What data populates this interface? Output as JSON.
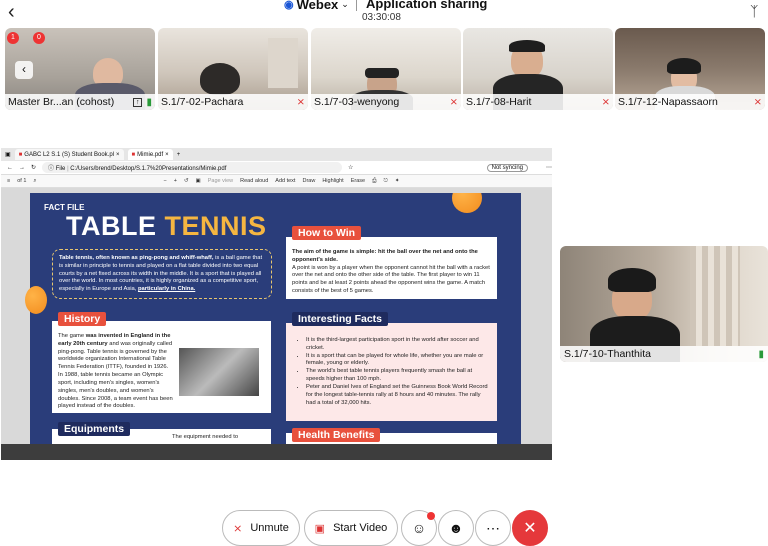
{
  "status": {
    "back_icon": "chevron-left-icon",
    "app_name": "Webex",
    "share_label": "Application sharing",
    "timer": "03:30:08",
    "bluetooth_icon": "bluetooth-icon"
  },
  "participants": [
    {
      "name": "Master Br...an (cohost)",
      "mic": "on"
    },
    {
      "name": "S.1/7-02-Pachara",
      "mic": "off"
    },
    {
      "name": "S.1/7-03-wenyong",
      "mic": "off"
    },
    {
      "name": "S.1/7-08-Harit",
      "mic": "off"
    },
    {
      "name": "S.1/7-12-Napassaorn",
      "mic": "off"
    }
  ],
  "first_tile_badges": [
    "1",
    "0"
  ],
  "side_participant": {
    "name": "S.1/7-10-Thanthita",
    "mic": "on"
  },
  "browser": {
    "tabs": [
      "GABC L2 S.1 (S) Student Book.pl",
      "Mimie.pdf"
    ],
    "file_label": "File",
    "url": "C:/Users/brend/Desktop/S.1.7%20Presentations/Mimie.pdf",
    "sync_label": "Not syncing",
    "page_counter": "of 1",
    "tools": [
      "Page view",
      "Read aloud",
      "Add text",
      "Draw",
      "Highlight",
      "Erase"
    ]
  },
  "pdf": {
    "fact_file": "FACT FILE",
    "title_a": "TABLE",
    "title_b": "TENNIS",
    "intro_bold": "Table tennis, often known as ping-pong and whiff-whaff,",
    "intro_rest": " is a ball game that is similar in principle to tennis and played on a flat table divided into two equal courts by a net fixed across its width in the middle. It is a sport that is played all over the world. In most countries, it is highly organized as a competitive sport, especially in Europe and Asia, ",
    "intro_link": "particularly in China.",
    "how_to_win": "How to Win",
    "htw_bold": "The aim of the game is simple: hit the ball over the net and onto the opponent's side.",
    "htw_text": "A point is won by a player when the opponent cannot hit the ball with a racket over the net and onto the other side of the table. The first player to win 11 points and be at least 2 points ahead the opponent wins the game. A match consists of the best of 5 games.",
    "history": "History",
    "history_text_a": "The game ",
    "history_bold": "was invented in England in the early 20th century",
    "history_text_b": " and was originally called ping-pong. Table tennis is governed by the worldwide organization International Table Tennis Federation (ITTF), founded in 1926.",
    "history_text_c": "In 1988, table tennis became an Olympic sport, including men's singles, women's singles, men's doubles, and women's doubles. Since 2008, a team event has been played instead of the doubles.",
    "facts": "Interesting Facts",
    "facts_list": [
      "It is the third-largest participation sport in the world after soccer and cricket.",
      "It is a sport that can be played for whole life, whether you are male or female, young or elderly.",
      "The world's best table tennis players frequently smash the ball at speeds higher than 100 mph.",
      "Peter and Daniel Ives of England set the Guinness Book World Record for the longest table-tennis rally at 8 hours and 40 minutes. The rally had a total of 32,000 hits."
    ],
    "equipments": "Equipments",
    "equip_text": "The equipment needed to",
    "health": "Health Benefits"
  },
  "controls": {
    "unmute": "Unmute",
    "start_video": "Start Video",
    "participants_icon": "participants-icon",
    "reactions_icon": "emoji-icon",
    "more_icon": "more-icon",
    "leave_icon": "close-icon"
  },
  "colors": {
    "pdf_navy": "#2a3d7a",
    "accent_red": "#e8513d",
    "leave_red": "#e5383b",
    "title_orange": "#f5b641"
  }
}
